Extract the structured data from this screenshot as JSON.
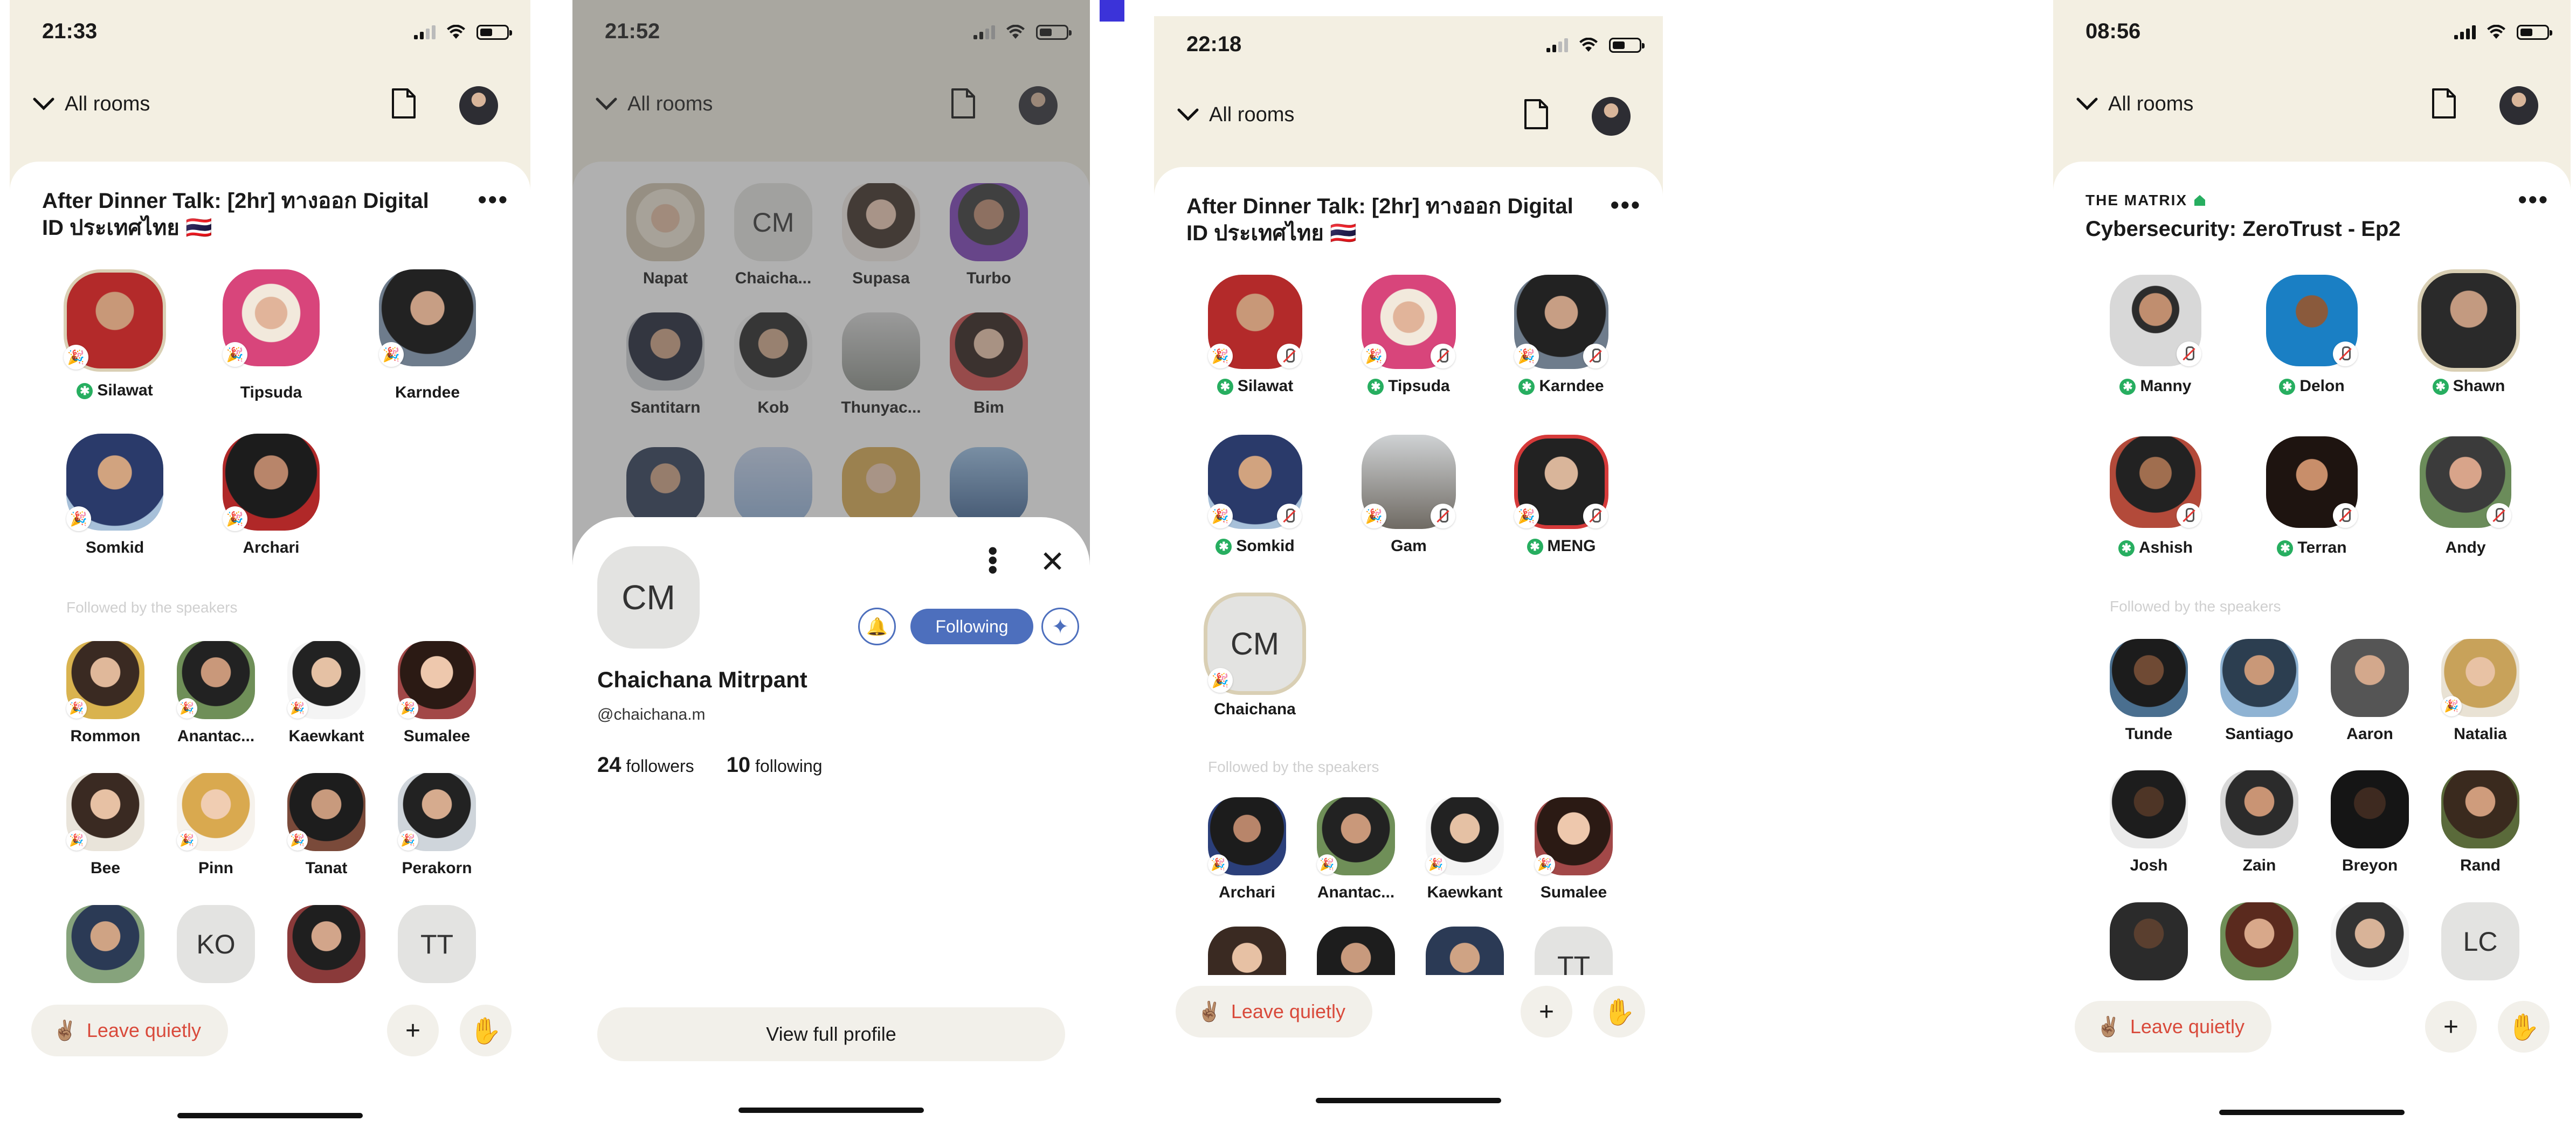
{
  "status_times": [
    "21:33",
    "21:52",
    "22:18",
    "08:56"
  ],
  "nav": {
    "all_rooms": "All rooms"
  },
  "more_glyph": "•••",
  "section_followed": "Followed by the speakers",
  "actions": {
    "leave": "Leave quietly",
    "leave_emoji": "✌🏽",
    "add": "+",
    "raise_hand": "✋"
  },
  "room1": {
    "title": "After Dinner Talk: [2hr] ทางออก Digital ID ประเทศไทย 🇹🇭",
    "speakers": [
      "Silawat",
      "Tipsuda",
      "Karndee",
      "Somkid",
      "Archari"
    ],
    "followed": [
      "Rommon",
      "Anantac...",
      "Kaewkant",
      "Sumalee",
      "Bee",
      "Pinn",
      "Tanat",
      "Perakorn"
    ],
    "partial_initials": [
      "KO",
      "TT"
    ]
  },
  "profile_sheet": {
    "grid_names": [
      "Napat",
      "Chaicha...",
      "Supasa",
      "Turbo",
      "Santitarn",
      "Kob",
      "Thunyac...",
      "Bim"
    ],
    "grid_initials": "CM",
    "avatar_initials": "CM",
    "name": "Chaichana Mitrpant",
    "handle": "@chaichana.m",
    "followers_count": "24",
    "followers_label": "followers",
    "following_count": "10",
    "following_label": "following",
    "following_button": "Following",
    "view_full_profile": "View full profile"
  },
  "room3": {
    "title": "After Dinner Talk: [2hr] ทางออก Digital ID ประเทศไทย 🇹🇭",
    "speakers": [
      "Silawat",
      "Tipsuda",
      "Karndee",
      "Somkid",
      "Gam",
      "MENG",
      "Chaichana"
    ],
    "speaker_initials": "CM",
    "followed": [
      "Archari",
      "Anantac...",
      "Kaewkant",
      "Sumalee"
    ],
    "partial_initials": "TT"
  },
  "room4": {
    "club": "THE MATRIX",
    "title": "Cybersecurity: ZeroTrust - Ep2",
    "speakers": [
      "Manny",
      "Delon",
      "Shawn",
      "Ashish",
      "Terran",
      "Andy"
    ],
    "followed": [
      "Tunde",
      "Santiago",
      "Aaron",
      "Natalia",
      "Josh",
      "Zain",
      "Breyon",
      "Rand"
    ],
    "partial_initials": "LC"
  },
  "colors": {
    "beige": "#f3efe2",
    "accent_blue": "#4d6fbd",
    "leave_red": "#d94a3b",
    "moderator_green": "#27ae60"
  }
}
